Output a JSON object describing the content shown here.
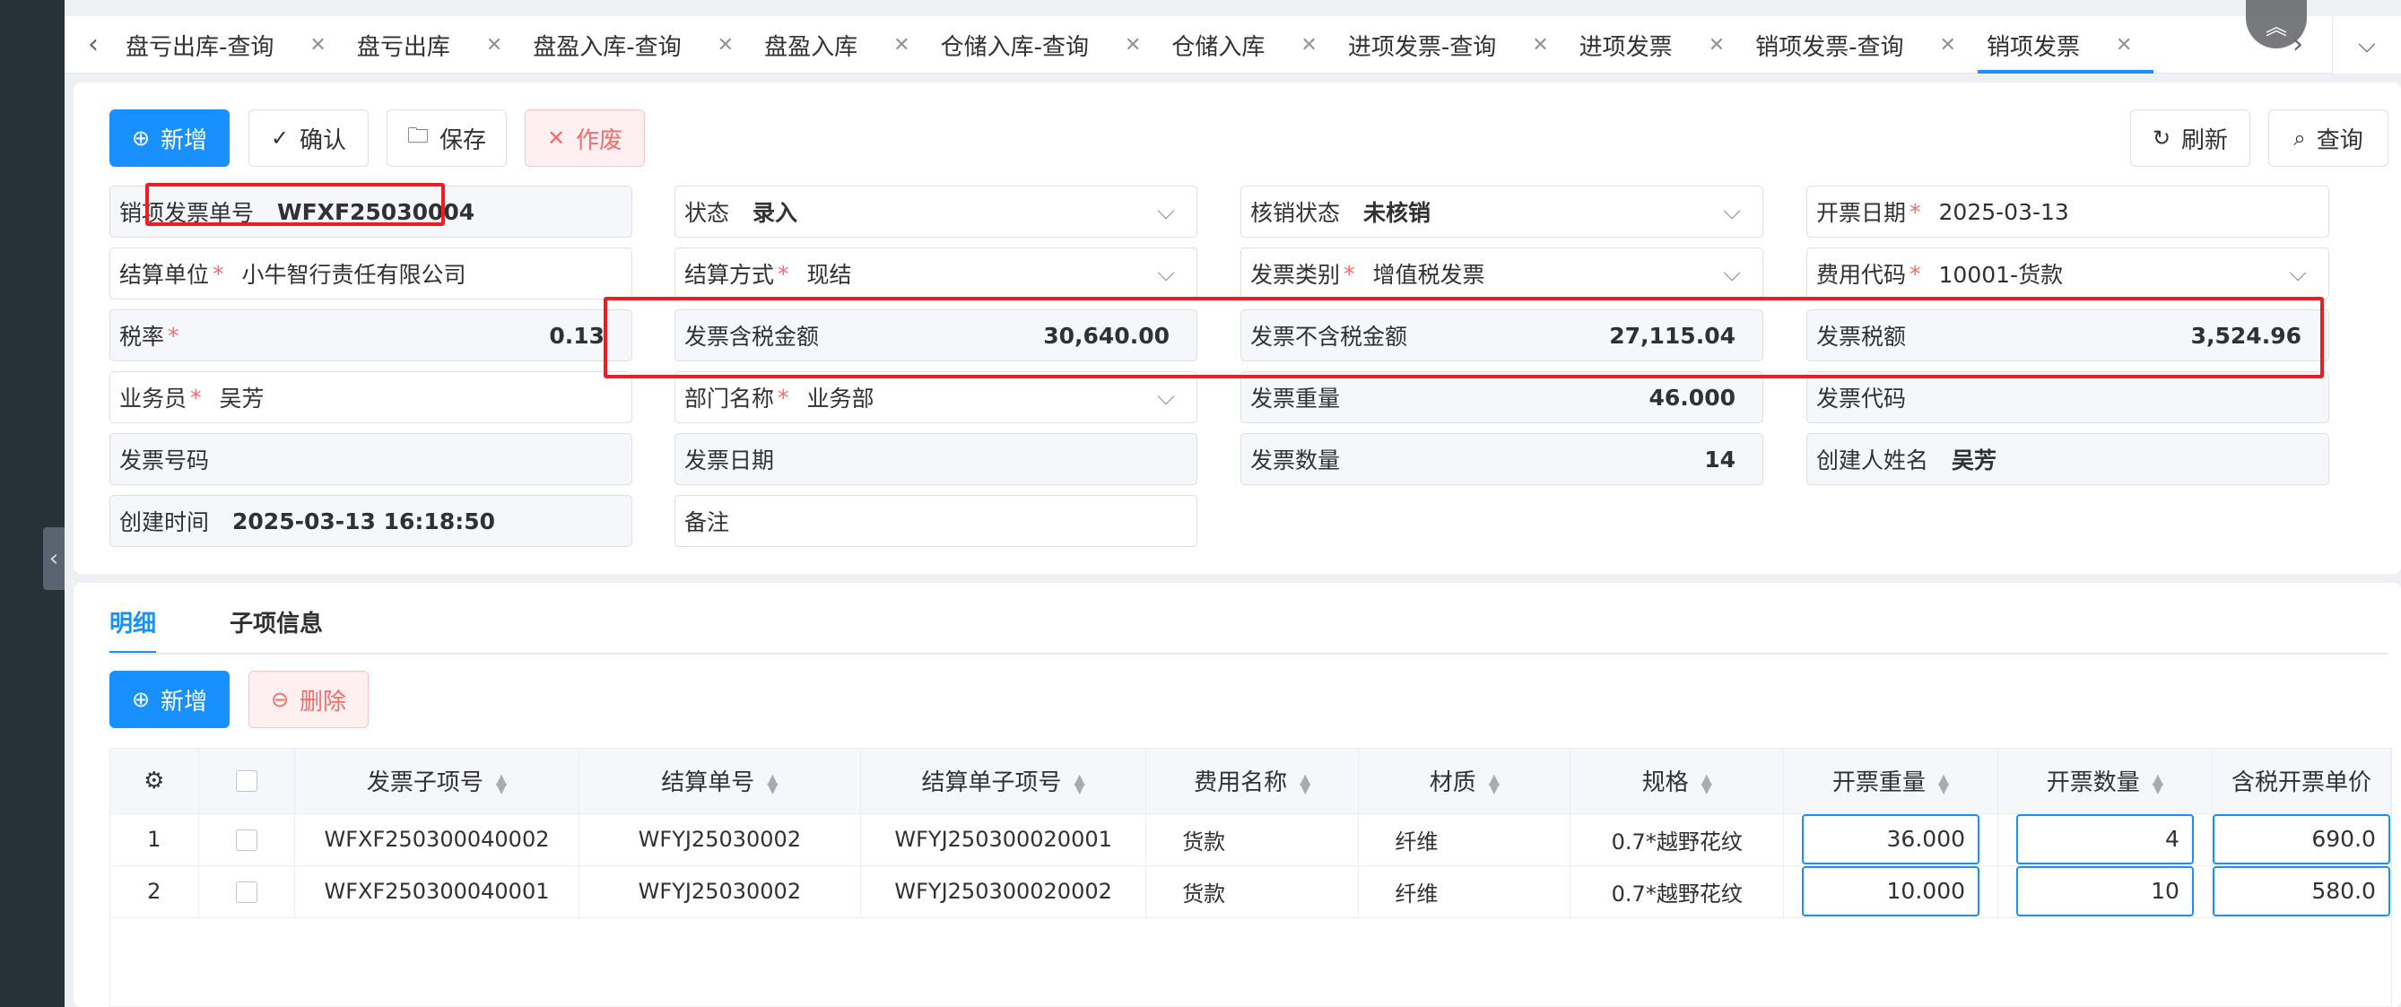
{
  "tabs": [
    {
      "label": "盘亏出库-查询",
      "active": false
    },
    {
      "label": "盘亏出库",
      "active": false
    },
    {
      "label": "盘盈入库-查询",
      "active": false
    },
    {
      "label": "盘盈入库",
      "active": false
    },
    {
      "label": "仓储入库-查询",
      "active": false
    },
    {
      "label": "仓储入库",
      "active": false
    },
    {
      "label": "进项发票-查询",
      "active": false
    },
    {
      "label": "进项发票",
      "active": false
    },
    {
      "label": "销项发票-查询",
      "active": false
    },
    {
      "label": "销项发票",
      "active": true
    }
  ],
  "toolbar": {
    "add": "新增",
    "confirm": "确认",
    "save": "保存",
    "void": "作废",
    "refresh": "刷新",
    "query": "查询"
  },
  "form": {
    "invoice_no": {
      "label": "销项发票单号",
      "value": "WFXF25030004"
    },
    "status": {
      "label": "状态",
      "value": "录入"
    },
    "verify_status": {
      "label": "核销状态",
      "value": "未核销"
    },
    "issue_date": {
      "label": "开票日期",
      "value": "2025-03-13"
    },
    "settle_unit": {
      "label": "结算单位",
      "value": "小牛智行责任有限公司"
    },
    "settle_method": {
      "label": "结算方式",
      "value": "现结"
    },
    "invoice_type": {
      "label": "发票类别",
      "value": "增值税发票"
    },
    "fee_code": {
      "label": "费用代码",
      "value": "10001-货款"
    },
    "tax_rate": {
      "label": "税率",
      "value": "0.13"
    },
    "amount_incl_tax": {
      "label": "发票含税金额",
      "value": "30,640.00"
    },
    "amount_excl_tax": {
      "label": "发票不含税金额",
      "value": "27,115.04"
    },
    "tax_amount": {
      "label": "发票税额",
      "value": "3,524.96"
    },
    "salesman": {
      "label": "业务员",
      "value": "吴芳"
    },
    "department": {
      "label": "部门名称",
      "value": "业务部"
    },
    "weight": {
      "label": "发票重量",
      "value": "46.000"
    },
    "invoice_code": {
      "label": "发票代码",
      "value": ""
    },
    "invoice_number": {
      "label": "发票号码",
      "value": ""
    },
    "invoice_date": {
      "label": "发票日期",
      "value": ""
    },
    "quantity": {
      "label": "发票数量",
      "value": "14"
    },
    "creator": {
      "label": "创建人姓名",
      "value": "吴芳"
    },
    "created_at": {
      "label": "创建时间",
      "value": "2025-03-13 16:18:50"
    },
    "remark": {
      "label": "备注",
      "value": ""
    }
  },
  "subtabs": [
    {
      "label": "明细",
      "active": true
    },
    {
      "label": "子项信息",
      "active": false
    }
  ],
  "detail_toolbar": {
    "add": "新增",
    "delete": "删除"
  },
  "table": {
    "columns": [
      "发票子项号",
      "结算单号",
      "结算单子项号",
      "费用名称",
      "材质",
      "规格",
      "开票重量",
      "开票数量",
      "含税开票单价"
    ],
    "rows": [
      {
        "idx": "1",
        "sub_no": "WFXF250300040002",
        "settle_no": "WFYJ25030002",
        "settle_sub_no": "WFYJ250300020001",
        "fee_name": "货款",
        "material": "纤维",
        "spec": "0.7*越野花纹",
        "weight": "36.000",
        "qty": "4",
        "price": "690.0"
      },
      {
        "idx": "2",
        "sub_no": "WFXF250300040001",
        "settle_no": "WFYJ25030002",
        "settle_sub_no": "WFYJ250300020002",
        "fee_name": "货款",
        "material": "纤维",
        "spec": "0.7*越野花纹",
        "weight": "10.000",
        "qty": "10",
        "price": "580.0"
      }
    ]
  },
  "colors": {
    "primary": "#1890ff",
    "danger": "#f56c6c",
    "highlight": "#ee1d23",
    "sidebar": "#263238"
  },
  "icons": [
    "plus-circle-icon",
    "check-icon",
    "folder-icon",
    "close-icon",
    "refresh-icon",
    "search-icon",
    "chevron-down-icon",
    "sort-icon",
    "gear-icon",
    "minus-circle-icon",
    "chevron-left-icon",
    "chevron-right-icon",
    "chevron-up-icon"
  ]
}
